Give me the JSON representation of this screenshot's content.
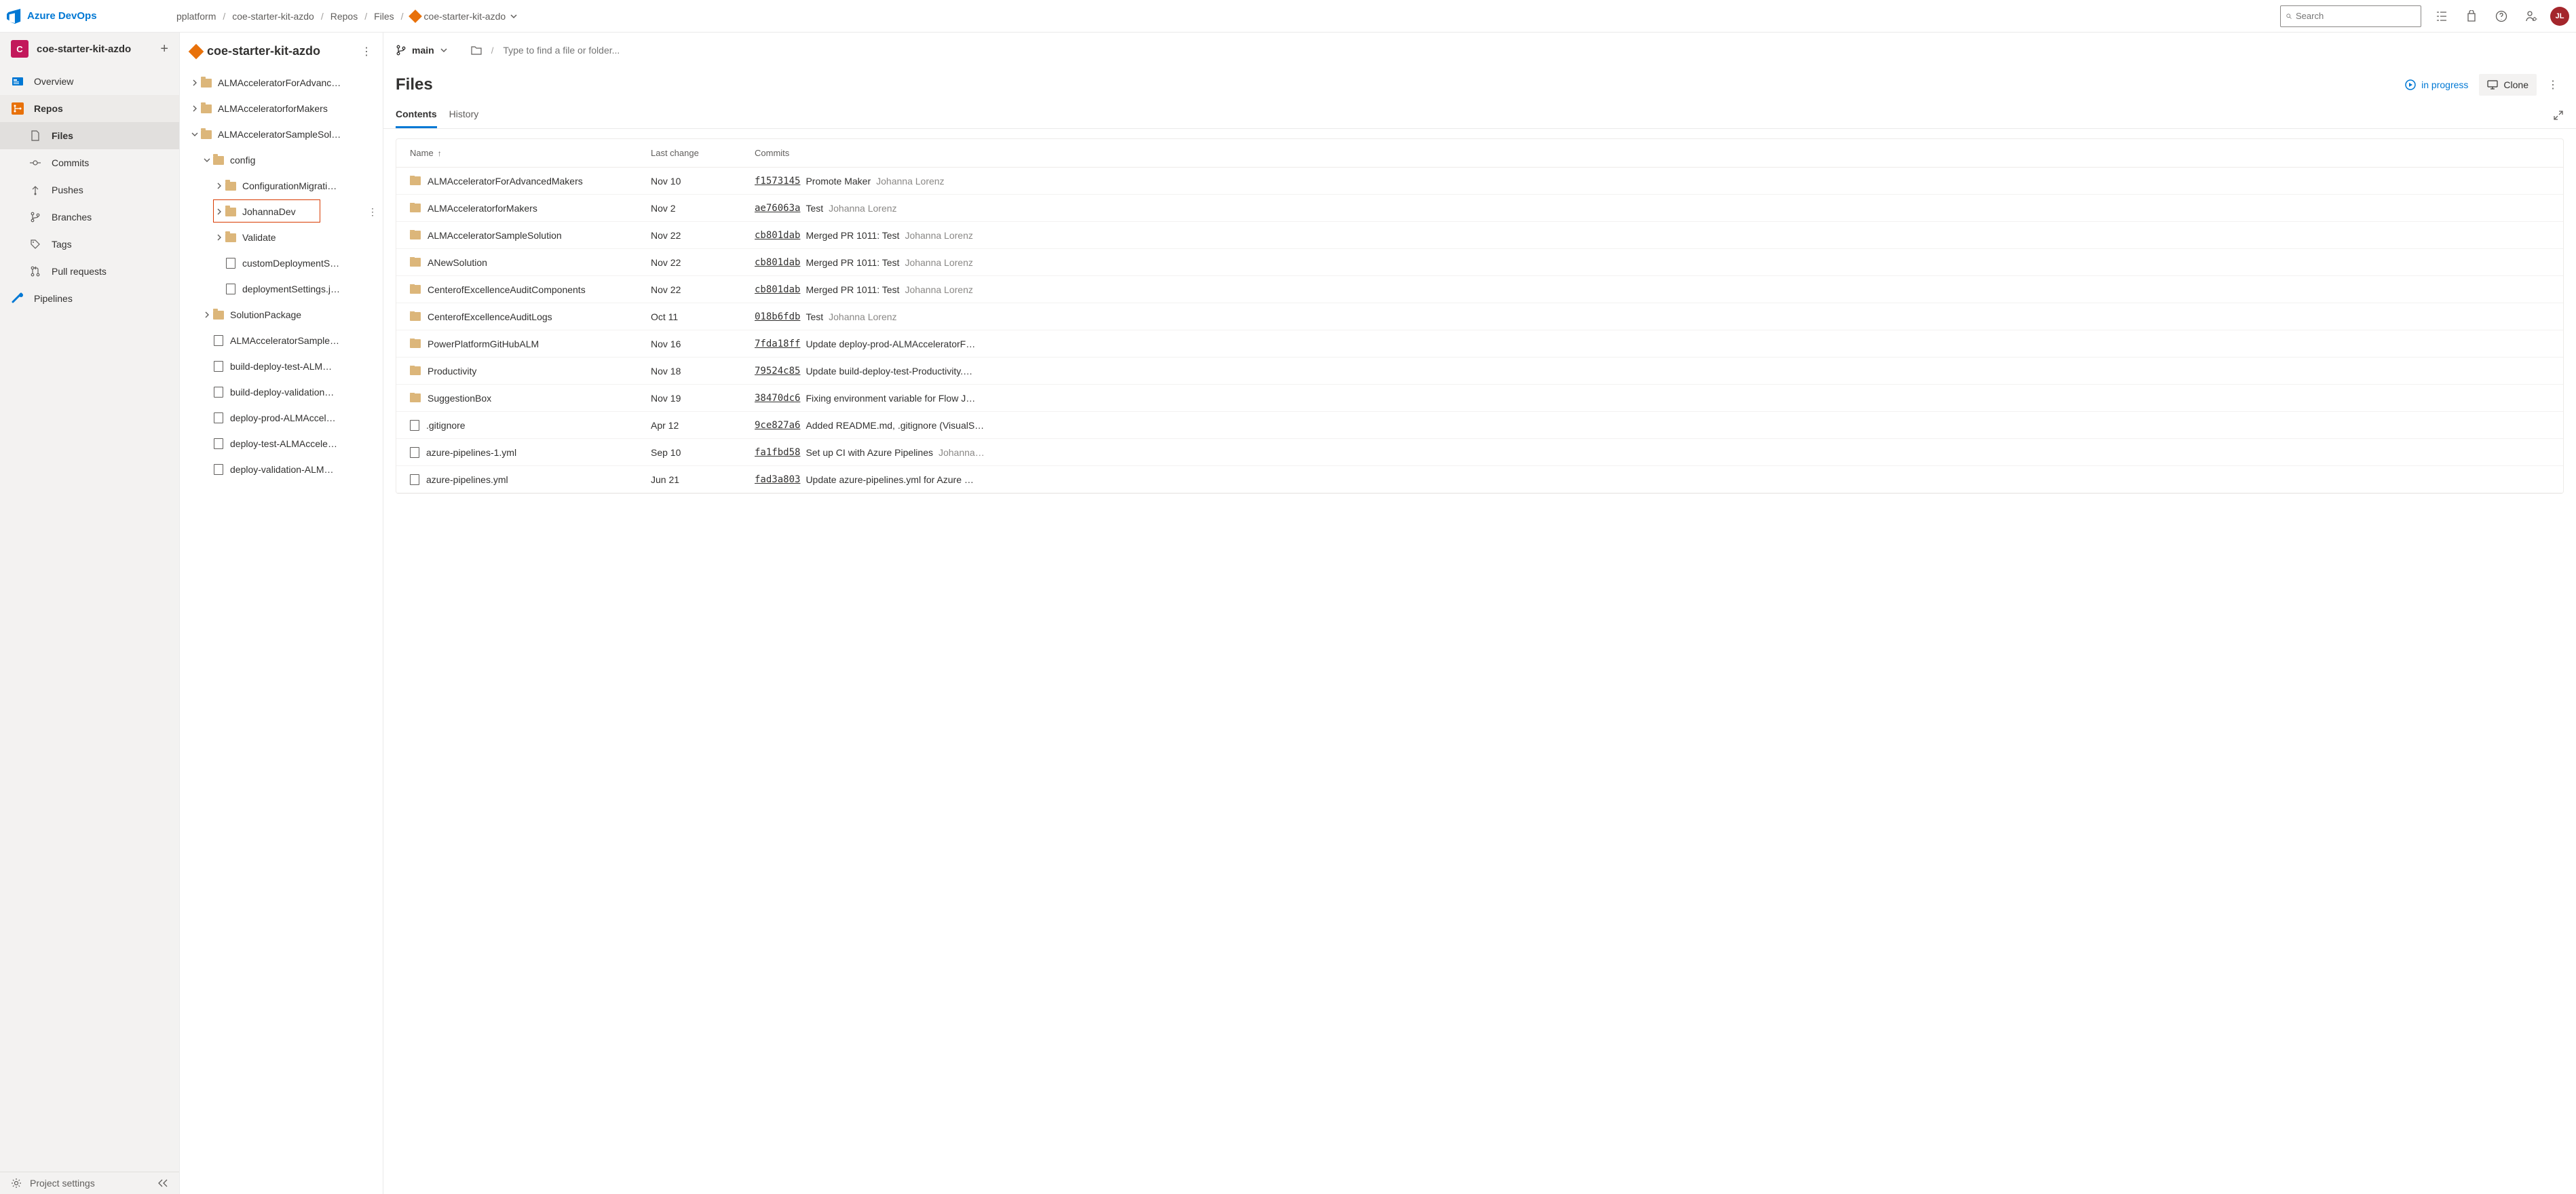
{
  "brand": "Azure DevOps",
  "breadcrumb": {
    "org": "pplatform",
    "project": "coe-starter-kit-azdo",
    "area": "Repos",
    "page": "Files",
    "repo": "coe-starter-kit-azdo"
  },
  "search": {
    "placeholder": "Search"
  },
  "avatar_initials": "JL",
  "project": {
    "initial": "C",
    "name": "coe-starter-kit-azdo"
  },
  "sidebar": {
    "items": [
      {
        "label": "Overview"
      },
      {
        "label": "Repos"
      },
      {
        "label": "Files"
      },
      {
        "label": "Commits"
      },
      {
        "label": "Pushes"
      },
      {
        "label": "Branches"
      },
      {
        "label": "Tags"
      },
      {
        "label": "Pull requests"
      },
      {
        "label": "Pipelines"
      }
    ],
    "footer": "Project settings"
  },
  "tree": {
    "repo": "coe-starter-kit-azdo",
    "nodes": [
      {
        "depth": 0,
        "type": "folder",
        "expand": "closed",
        "label": "ALMAcceleratorForAdvanc…"
      },
      {
        "depth": 0,
        "type": "folder",
        "expand": "closed",
        "label": "ALMAcceleratorforMakers"
      },
      {
        "depth": 0,
        "type": "folder",
        "expand": "open",
        "label": "ALMAcceleratorSampleSol…"
      },
      {
        "depth": 1,
        "type": "folder",
        "expand": "open",
        "label": "config"
      },
      {
        "depth": 2,
        "type": "folder",
        "expand": "closed",
        "label": "ConfigurationMigrati…"
      },
      {
        "depth": 2,
        "type": "folder",
        "expand": "closed",
        "label": "JohannaDev",
        "highlight": true,
        "show_more": true
      },
      {
        "depth": 2,
        "type": "folder",
        "expand": "closed",
        "label": "Validate"
      },
      {
        "depth": 2,
        "type": "file",
        "label": "customDeploymentS…"
      },
      {
        "depth": 2,
        "type": "file",
        "label": "deploymentSettings.j…"
      },
      {
        "depth": 1,
        "type": "folder",
        "expand": "closed",
        "label": "SolutionPackage"
      },
      {
        "depth": 1,
        "type": "file",
        "label": "ALMAcceleratorSample…"
      },
      {
        "depth": 1,
        "type": "file",
        "label": "build-deploy-test-ALM…"
      },
      {
        "depth": 1,
        "type": "file",
        "label": "build-deploy-validation…"
      },
      {
        "depth": 1,
        "type": "file",
        "label": "deploy-prod-ALMAccel…"
      },
      {
        "depth": 1,
        "type": "file",
        "label": "deploy-test-ALMAccele…"
      },
      {
        "depth": 1,
        "type": "file",
        "label": "deploy-validation-ALM…"
      }
    ]
  },
  "branch": {
    "name": "main"
  },
  "path_input": {
    "placeholder": "Type to find a file or folder..."
  },
  "content": {
    "title": "Files",
    "in_progress": "in progress",
    "clone": "Clone",
    "tabs": {
      "contents": "Contents",
      "history": "History"
    }
  },
  "table": {
    "headers": {
      "name": "Name",
      "last_change": "Last change",
      "commits": "Commits"
    },
    "rows": [
      {
        "type": "folder",
        "name": "ALMAcceleratorForAdvancedMakers",
        "date": "Nov 10",
        "hash": "f1573145",
        "msg": "Promote Maker",
        "author": "Johanna Lorenz"
      },
      {
        "type": "folder",
        "name": "ALMAcceleratorforMakers",
        "date": "Nov 2",
        "hash": "ae76063a",
        "msg": "Test",
        "author": "Johanna Lorenz"
      },
      {
        "type": "folder",
        "name": "ALMAcceleratorSampleSolution",
        "date": "Nov 22",
        "hash": "cb801dab",
        "msg": "Merged PR 1011: Test",
        "author": "Johanna Lorenz"
      },
      {
        "type": "folder",
        "name": "ANewSolution",
        "date": "Nov 22",
        "hash": "cb801dab",
        "msg": "Merged PR 1011: Test",
        "author": "Johanna Lorenz"
      },
      {
        "type": "folder",
        "name": "CenterofExcellenceAuditComponents",
        "date": "Nov 22",
        "hash": "cb801dab",
        "msg": "Merged PR 1011: Test",
        "author": "Johanna Lorenz"
      },
      {
        "type": "folder",
        "name": "CenterofExcellenceAuditLogs",
        "date": "Oct 11",
        "hash": "018b6fdb",
        "msg": "Test",
        "author": "Johanna Lorenz"
      },
      {
        "type": "folder",
        "name": "PowerPlatformGitHubALM",
        "date": "Nov 16",
        "hash": "7fda18ff",
        "msg": "Update deploy-prod-ALMAcceleratorF…",
        "author": ""
      },
      {
        "type": "folder",
        "name": "Productivity",
        "date": "Nov 18",
        "hash": "79524c85",
        "msg": "Update build-deploy-test-Productivity.…",
        "author": ""
      },
      {
        "type": "folder",
        "name": "SuggestionBox",
        "date": "Nov 19",
        "hash": "38470dc6",
        "msg": "Fixing environment variable for Flow J…",
        "author": ""
      },
      {
        "type": "file",
        "name": ".gitignore",
        "date": "Apr 12",
        "hash": "9ce827a6",
        "msg": "Added README.md, .gitignore (VisualS…",
        "author": ""
      },
      {
        "type": "file",
        "name": "azure-pipelines-1.yml",
        "date": "Sep 10",
        "hash": "fa1fbd58",
        "msg": "Set up CI with Azure Pipelines",
        "author": "Johanna…"
      },
      {
        "type": "file",
        "name": "azure-pipelines.yml",
        "date": "Jun 21",
        "hash": "fad3a803",
        "msg": "Update azure-pipelines.yml for Azure …",
        "author": ""
      }
    ]
  }
}
